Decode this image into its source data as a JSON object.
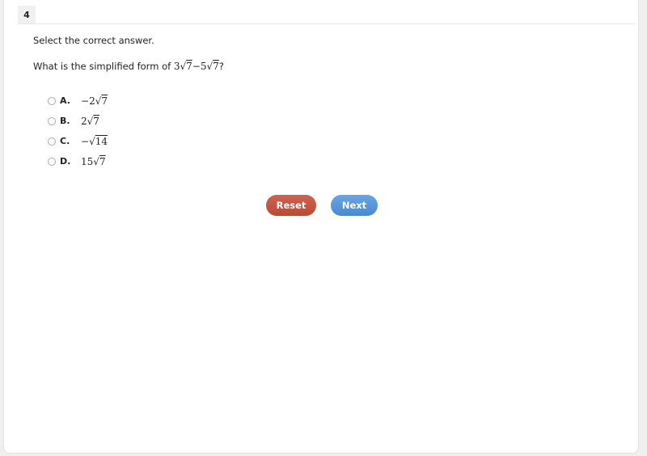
{
  "question": {
    "number": "4",
    "instruction": "Select the correct answer.",
    "prompt_prefix": "What is the simplified form of ",
    "expression": {
      "term1_coef": "3",
      "term1_radicand": "7",
      "operator": "−",
      "term2_coef": "5",
      "term2_radicand": "7"
    },
    "prompt_suffix": "?"
  },
  "options": [
    {
      "letter": "A.",
      "sign": "−",
      "coef": "2",
      "radicand": "7",
      "selected": false
    },
    {
      "letter": "B.",
      "sign": "",
      "coef": "2",
      "radicand": "7",
      "selected": false
    },
    {
      "letter": "C.",
      "sign": "−",
      "coef": "",
      "radicand": "14",
      "selected": false
    },
    {
      "letter": "D.",
      "sign": "",
      "coef": "15",
      "radicand": "7",
      "selected": false
    }
  ],
  "buttons": {
    "reset_label": "Reset",
    "next_label": "Next",
    "reset_color": "#c0523f",
    "next_color": "#5596db"
  },
  "symbols": {
    "sqrt": "√"
  }
}
